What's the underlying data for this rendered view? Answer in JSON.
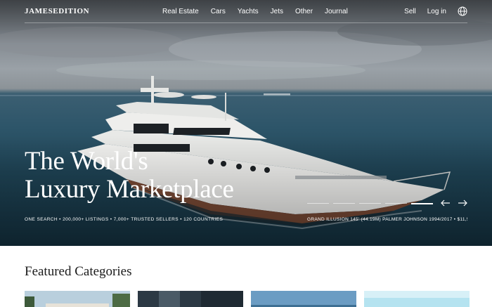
{
  "nav": {
    "logo": "JAMESEDITION",
    "links": [
      "Real Estate",
      "Cars",
      "Yachts",
      "Jets",
      "Other",
      "Journal"
    ],
    "sell": "Sell",
    "login": "Log in",
    "language_icon": "globe-icon"
  },
  "hero": {
    "title_line1": "The World's",
    "title_line2": "Luxury Marketplace",
    "subtitle": "ONE SEARCH • 200,000+ LISTINGS • 7,000+ TRUSTED SELLERS • 120 COUNTRIES",
    "caption": "GRAND ILLUSION 145' (44.19M) PALMER JOHNSON 1994/2017 • $11,5...",
    "slides_total": 5,
    "active_slide": 5,
    "prev_icon": "arrow-left-icon",
    "next_icon": "arrow-right-icon"
  },
  "featured": {
    "title": "Featured Categories",
    "cards": [
      "real-estate-card",
      "cars-card",
      "yachts-card",
      "jets-card"
    ]
  },
  "colors": {
    "text_dark": "#1b1b1b",
    "white": "#ffffff"
  }
}
